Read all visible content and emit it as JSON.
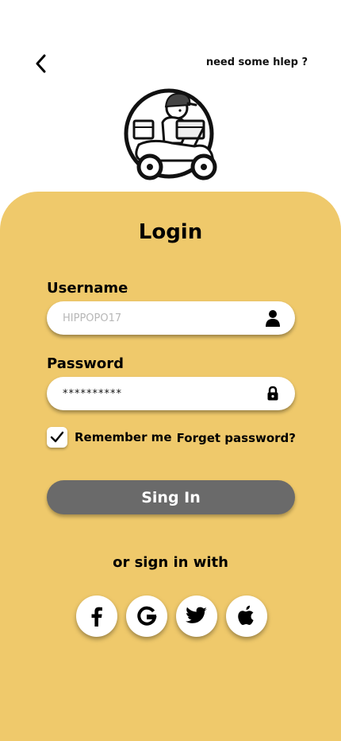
{
  "header": {
    "help_link": "need some hlep ?"
  },
  "login": {
    "title": "Login",
    "username_label": "Username",
    "username_placeholder": "HIPPOPO17",
    "password_label": "Password",
    "password_value": "**********",
    "remember_label": "Remember me",
    "remember_checked": true,
    "forgot_label": "Forget password?",
    "signin_label": "Sing In",
    "or_text": "or sign in with"
  },
  "social": [
    "facebook-icon",
    "google-icon",
    "twitter-icon",
    "apple-icon"
  ],
  "colors": {
    "panel": "#efc96b",
    "button": "#6a6a6a",
    "field": "#ffffff"
  }
}
